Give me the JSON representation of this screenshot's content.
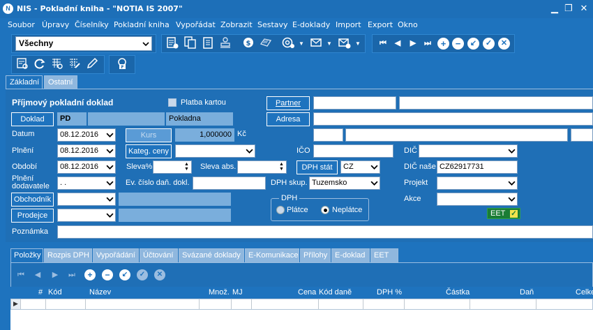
{
  "window": {
    "title": "NIS - Pokladní kniha - \"NOTIA IS 2007\"",
    "app_icon": "notia-logo-icon",
    "controls": [
      "minimize-icon",
      "maximize-icon",
      "close-icon"
    ]
  },
  "menu": [
    "Soubor",
    "Úpravy",
    "Číselníky",
    "Pokladní kniha",
    "Vypořádat",
    "Zobrazit",
    "Sestavy",
    "E-doklady",
    "Import",
    "Export",
    "Okno"
  ],
  "toolbar": {
    "filter_value": "Všechny",
    "icons_row1": [
      "new-doc-icon",
      "copy-doc-icon",
      "clipboard-icon",
      "stamp-icon",
      "currency-icon",
      "printer-icon",
      "email-icon",
      "envelope-icon",
      "send-icon"
    ],
    "nav_icons": [
      "first-icon",
      "prev-icon",
      "next-icon",
      "last-icon",
      "add-icon",
      "remove-icon",
      "edit-icon",
      "confirm-icon",
      "cancel-icon"
    ],
    "icons_row2": [
      "list-search-icon",
      "refresh-icon",
      "grid-search-icon",
      "grid-edit-icon",
      "pencil-icon",
      "lock-icon"
    ]
  },
  "tabs": [
    {
      "label": "Základní",
      "active": true
    },
    {
      "label": "Ostatní",
      "active": false
    }
  ],
  "form": {
    "heading": "Příjmový pokladní doklad",
    "platba_kartou": "Platba kartou",
    "doklad_btn": "Doklad",
    "doklad_code": "PD",
    "doklad_name": "Pokladna",
    "datum_label": "Datum",
    "datum": "08.12.2016",
    "kurs_btn": "Kurs",
    "kurs_value": "1,000000",
    "kurs_currency": "Kč",
    "plneni_label": "Plnění",
    "plneni": "08.12.2016",
    "kateg_btn": "Kateg. ceny",
    "obdobi_label": "Období",
    "obdobi": "08.12.2016",
    "sleva_pct_label": "Sleva%",
    "sleva_abs_label": "Sleva abs.",
    "plneni_dod_label1": "Plnění",
    "plneni_dod_label2": "dodavatele",
    "plneni_dod": ". .",
    "ev_cislo_label": "Ev. číslo daň. dokl.",
    "obchodnik_btn": "Obchodník",
    "prodejce_btn": "Prodejce",
    "poznamka_label": "Poznámka",
    "partner_btn": "Partner",
    "adresa_btn": "Adresa",
    "ico_label": "IČO",
    "dic_label": "DIČ",
    "dph_stat_btn": "DPH stát",
    "dph_stat": "CZ",
    "dic_nase_label": "DIČ naše",
    "dic_nase": "CZ62917731",
    "dph_skup_label": "DPH skup.",
    "dph_skup": "Tuzemsko",
    "projekt_label": "Projekt",
    "akce_label": "Akce",
    "dph_group_title": "DPH",
    "dph_platce": "Plátce",
    "dph_neplatce": "Neplátce",
    "dph_selected": "Neplátce",
    "eet_label": "EET",
    "eet_checked": true
  },
  "bottom_tabs": [
    {
      "label": "Položky",
      "active": true
    },
    {
      "label": "Rozpis DPH",
      "active": false
    },
    {
      "label": "Vypořádání",
      "active": false
    },
    {
      "label": "Účtování",
      "active": false
    },
    {
      "label": "Svázané doklady",
      "active": false
    },
    {
      "label": "E-Komunikace",
      "active": false
    },
    {
      "label": "Přílohy",
      "active": false
    },
    {
      "label": "E-doklad",
      "active": false
    },
    {
      "label": "EET",
      "active": false
    }
  ],
  "grid": {
    "columns": [
      "#",
      "Kód",
      "Název",
      "Množ.",
      "MJ",
      "Cena",
      "Kód daně",
      "DPH %",
      "Částka",
      "Daň",
      "Celke"
    ]
  },
  "colors": {
    "background": "#1e73be",
    "eet_badge": "#1a7d35",
    "eet_check": "#f3e34d"
  }
}
